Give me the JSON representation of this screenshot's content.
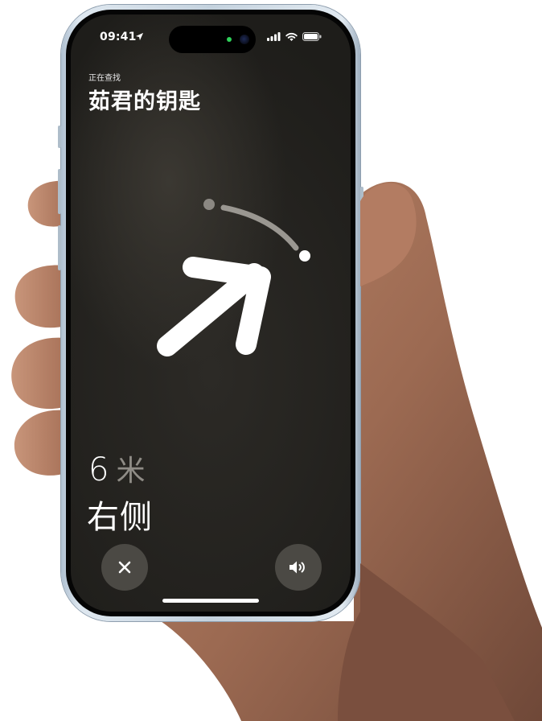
{
  "status_bar": {
    "time": "09:41",
    "location_icon": "location-arrow-icon",
    "signal_icon": "cellular-signal-icon",
    "wifi_icon": "wifi-icon",
    "battery_icon": "battery-icon"
  },
  "header": {
    "subtitle": "正在查找",
    "title": "茹君的钥匙"
  },
  "guidance": {
    "arrow_icon": "direction-arrow-icon",
    "distance_value": "6",
    "distance_unit": "米",
    "direction_label": "右侧"
  },
  "controls": {
    "close_icon": "close-icon",
    "sound_icon": "speaker-sound-icon"
  },
  "colors": {
    "screen_background": "#23221f",
    "text_primary": "#ffffff",
    "text_secondary": "#8f8c86",
    "button_background": "#4b4944",
    "island_indicator": "#2fd15a"
  }
}
